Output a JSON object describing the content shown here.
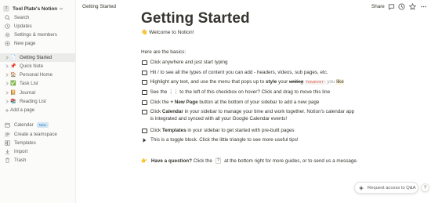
{
  "sidebar": {
    "workspace": {
      "avatar_letter": "T",
      "name": "Tool Plate's Notion"
    },
    "top_items": [
      {
        "label": "Search",
        "icon": "search-icon"
      },
      {
        "label": "Updates",
        "icon": "clock-icon"
      },
      {
        "label": "Settings & members",
        "icon": "gear-icon"
      },
      {
        "label": "New page",
        "icon": "plus-circle-icon"
      }
    ],
    "pages": [
      {
        "label": "Getting Started",
        "emoji": "📄",
        "active": true
      },
      {
        "label": "Quick Note",
        "emoji": "📌"
      },
      {
        "label": "Personal Home",
        "emoji": "🏠"
      },
      {
        "label": "Task List",
        "emoji": "✅"
      },
      {
        "label": "Journal",
        "emoji": "📔"
      },
      {
        "label": "Reading List",
        "emoji": "📚"
      }
    ],
    "add_page": "Add a page",
    "bottom_items": [
      {
        "label": "Calendar",
        "icon": "calendar-icon",
        "badge": "New"
      },
      {
        "label": "Create a teamspace",
        "icon": "teamspace-icon"
      },
      {
        "label": "Templates",
        "icon": "templates-icon"
      },
      {
        "label": "Import",
        "icon": "import-icon"
      },
      {
        "label": "Trash",
        "icon": "trash-icon"
      }
    ]
  },
  "topbar": {
    "breadcrumb": "Getting Started",
    "share_label": "Share",
    "icons": [
      "comment-icon",
      "clock-icon",
      "star-icon",
      "more-icon"
    ]
  },
  "page": {
    "title": "Getting Started",
    "welcome_emoji": "👋",
    "welcome_text": "Welcome to Notion!",
    "basics_heading": "Here are the basics:",
    "todos": [
      {
        "parts": [
          "Click anywhere and just start typing"
        ]
      },
      {
        "parts": [
          "Hit / to see all the types of content you can add - headers, videos, sub pages, etc."
        ]
      },
      {
        "prefix": "Highlight any text, and use the menu that pops up to ",
        "bold": "style",
        "mid": " your ",
        "strike": "writing",
        "code": "however",
        "grey": " you ",
        "highlight": "like"
      },
      {
        "parts": [
          "See the ⋮⋮ to the left of this checkbox on hover? Click and drag to move this line"
        ]
      },
      {
        "prefix": "Click the ",
        "bold": "+ New Page",
        "suffix": " button at the bottom of your sidebar to add a new page"
      },
      {
        "prefix": "Click ",
        "bold": "Calendar",
        "suffix": " in your sidebar to manage your time and work together. Notion's calendar app",
        "line2": "is integrated and synced with all your Google Calendar events!"
      },
      {
        "prefix": "Click ",
        "bold": "Templates",
        "suffix": " in your sidebar to get started with pre-built pages"
      }
    ],
    "toggle_text": "This is a toggle block. Click the little triangle to see more useful tips!",
    "callout": {
      "emoji": "👉",
      "bold": "Have a question?",
      "pre_key": " Click the ",
      "key": "?",
      "post_key": " at the bottom right for more guides, or to send us a message."
    }
  },
  "qa_button": {
    "label": "Request access to Q&A",
    "icon": "qa-sparkle-icon"
  },
  "help_button": {
    "label": "?"
  },
  "colors": {
    "sidebar_bg": "#fbfbfa",
    "text": "#37352f",
    "muted": "#91918e",
    "accent": "#2383e2",
    "code_red": "#eb5757"
  }
}
